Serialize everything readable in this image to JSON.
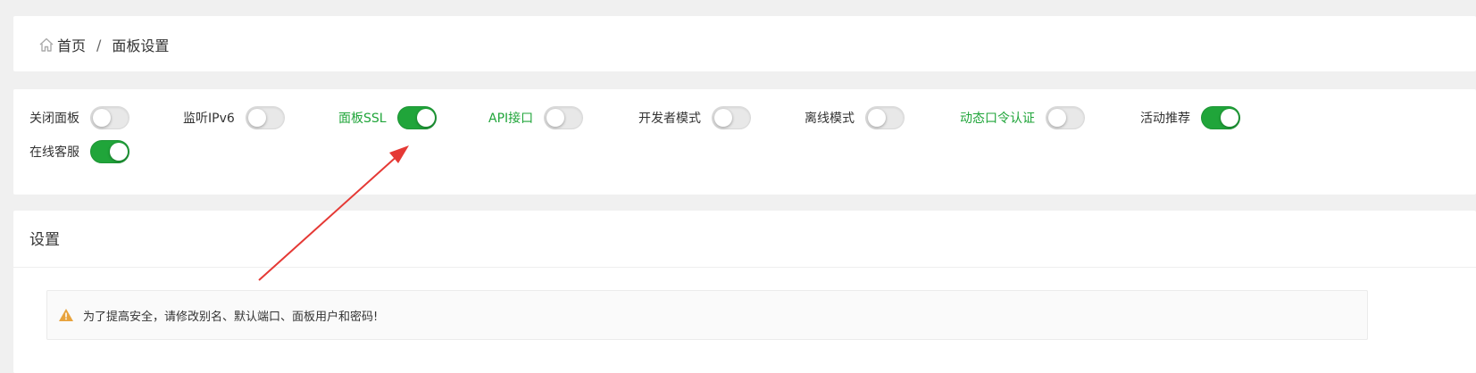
{
  "breadcrumb": {
    "home_label": "首页",
    "separator": "/",
    "current_label": "面板设置"
  },
  "toggles": [
    {
      "label": "关闭面板",
      "state": "off",
      "highlight": false
    },
    {
      "label": "监听IPv6",
      "state": "off",
      "highlight": false
    },
    {
      "label": "面板SSL",
      "state": "on",
      "highlight": true
    },
    {
      "label": "API接口",
      "state": "off",
      "highlight": true
    },
    {
      "label": "开发者模式",
      "state": "off",
      "highlight": false
    },
    {
      "label": "离线模式",
      "state": "off",
      "highlight": false
    },
    {
      "label": "动态口令认证",
      "state": "off",
      "highlight": true
    },
    {
      "label": "活动推荐",
      "state": "on",
      "highlight": false
    },
    {
      "label": "在线客服",
      "state": "on",
      "highlight": false
    }
  ],
  "settings": {
    "title": "设置",
    "alert_text": "为了提高安全，请修改别名、默认端口、面板用户和密码!"
  },
  "colors": {
    "accent_green": "#20a53a",
    "warning_orange": "#e8a33d",
    "annotation_red": "#e53935"
  },
  "icons": {
    "home": "home-icon",
    "warning": "warning-icon"
  }
}
